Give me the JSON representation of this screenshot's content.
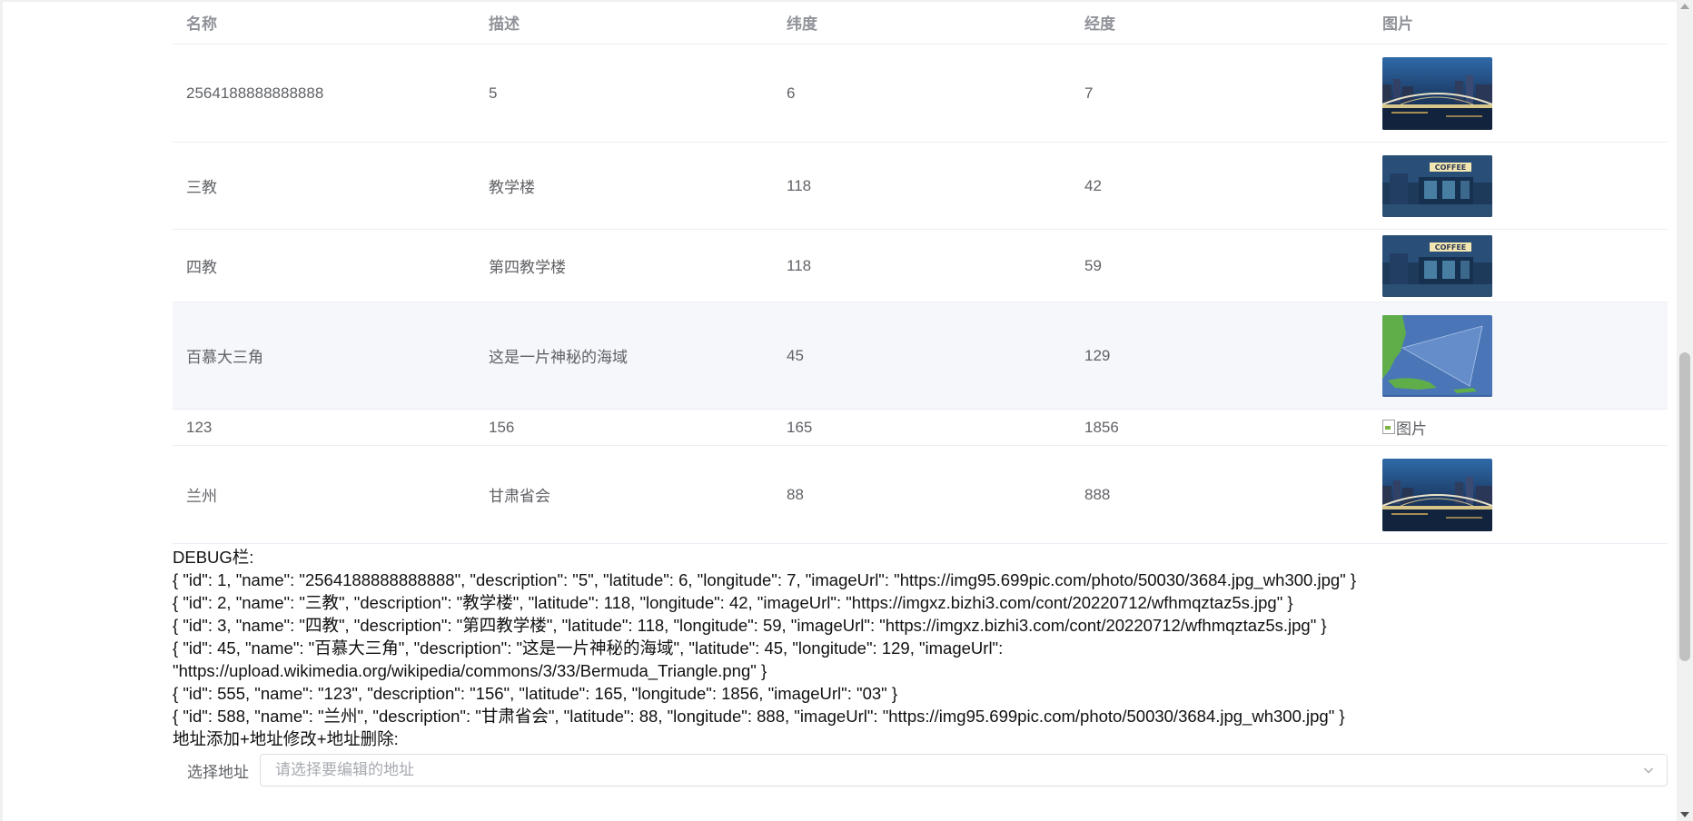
{
  "table": {
    "headers": {
      "name": "名称",
      "description": "描述",
      "latitude": "纬度",
      "longitude": "经度",
      "image": "图片"
    },
    "rows": [
      {
        "name": "2564188888888888",
        "description": "5",
        "latitude": "6",
        "longitude": "7",
        "image": "city-bridge"
      },
      {
        "name": "三教",
        "description": "教学楼",
        "latitude": "118",
        "longitude": "42",
        "image": "coffee-shop"
      },
      {
        "name": "四教",
        "description": "第四教学楼",
        "latitude": "118",
        "longitude": "59",
        "image": "coffee-shop"
      },
      {
        "name": "百慕大三角",
        "description": "这是一片神秘的海域",
        "latitude": "45",
        "longitude": "129",
        "image": "bermuda-map"
      },
      {
        "name": "123",
        "description": "156",
        "latitude": "165",
        "longitude": "1856",
        "image": "broken",
        "image_alt": "图片"
      },
      {
        "name": "兰州",
        "description": "甘肃省会",
        "latitude": "88",
        "longitude": "888",
        "image": "city-bridge"
      }
    ]
  },
  "debug": {
    "title": "DEBUG栏:",
    "lines": [
      "{ \"id\": 1, \"name\": \"2564188888888888\", \"description\": \"5\", \"latitude\": 6, \"longitude\": 7, \"imageUrl\": \"https://img95.699pic.com/photo/50030/3684.jpg_wh300.jpg\" }",
      "{ \"id\": 2, \"name\": \"三教\", \"description\": \"教学楼\", \"latitude\": 118, \"longitude\": 42, \"imageUrl\": \"https://imgxz.bizhi3.com/cont/20220712/wfhmqztaz5s.jpg\" }",
      "{ \"id\": 3, \"name\": \"四教\", \"description\": \"第四教学楼\", \"latitude\": 118, \"longitude\": 59, \"imageUrl\": \"https://imgxz.bizhi3.com/cont/20220712/wfhmqztaz5s.jpg\" }",
      "{ \"id\": 45, \"name\": \"百慕大三角\", \"description\": \"这是一片神秘的海域\", \"latitude\": 45, \"longitude\": 129, \"imageUrl\":",
      "\"https://upload.wikimedia.org/wikipedia/commons/3/33/Bermuda_Triangle.png\" }",
      "{ \"id\": 555, \"name\": \"123\", \"description\": \"156\", \"latitude\": 165, \"longitude\": 1856, \"imageUrl\": \"03\" }",
      "{ \"id\": 588, \"name\": \"兰州\", \"description\": \"甘肃省会\", \"latitude\": 88, \"longitude\": 888, \"imageUrl\": \"https://img95.699pic.com/photo/50030/3684.jpg_wh300.jpg\" }"
    ],
    "section_label": "地址添加+地址修改+地址删除:"
  },
  "address_select": {
    "label": "选择地址",
    "placeholder": "请选择要编辑的地址"
  }
}
